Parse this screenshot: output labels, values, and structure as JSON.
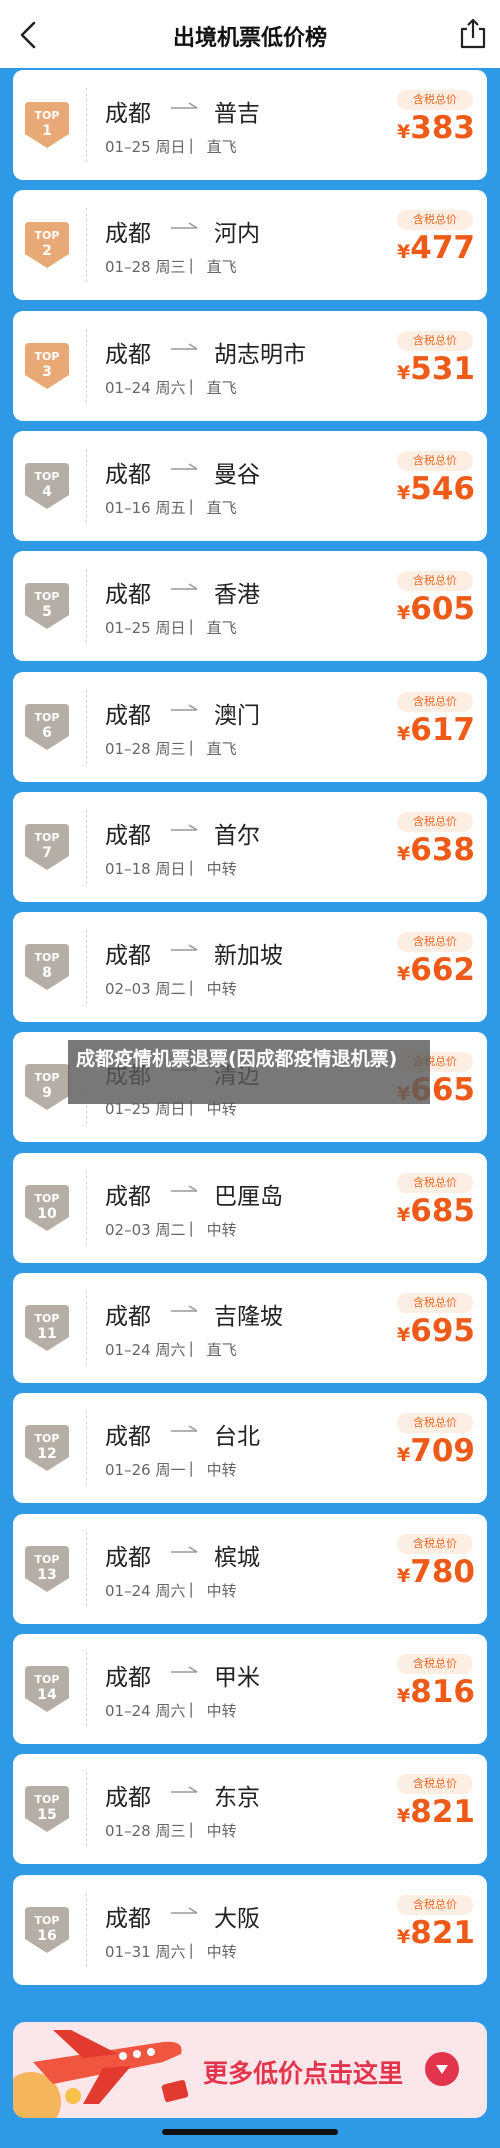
{
  "header": {
    "title": "出境机票低价榜"
  },
  "colors": {
    "accent": "#2e9ae6",
    "price": "#ee5a17",
    "badge_gold": "#e9a977",
    "badge_gray": "#b5aea6",
    "banner": "#e3344d"
  },
  "routes": [
    {
      "rank": "1",
      "from": "成都",
      "to": "普吉",
      "date": "01–25 周日",
      "type": "直飞",
      "tag": "含税总价",
      "currency": "¥",
      "price": "383",
      "tier": "gold"
    },
    {
      "rank": "2",
      "from": "成都",
      "to": "河内",
      "date": "01–28 周三",
      "type": "直飞",
      "tag": "含税总价",
      "currency": "¥",
      "price": "477",
      "tier": "gold"
    },
    {
      "rank": "3",
      "from": "成都",
      "to": "胡志明市",
      "date": "01–24 周六",
      "type": "直飞",
      "tag": "含税总价",
      "currency": "¥",
      "price": "531",
      "tier": "gold"
    },
    {
      "rank": "4",
      "from": "成都",
      "to": "曼谷",
      "date": "01–16 周五",
      "type": "直飞",
      "tag": "含税总价",
      "currency": "¥",
      "price": "546",
      "tier": "gray"
    },
    {
      "rank": "5",
      "from": "成都",
      "to": "香港",
      "date": "01–25 周日",
      "type": "直飞",
      "tag": "含税总价",
      "currency": "¥",
      "price": "605",
      "tier": "gray"
    },
    {
      "rank": "6",
      "from": "成都",
      "to": "澳门",
      "date": "01–28 周三",
      "type": "直飞",
      "tag": "含税总价",
      "currency": "¥",
      "price": "617",
      "tier": "gray"
    },
    {
      "rank": "7",
      "from": "成都",
      "to": "首尔",
      "date": "01–18 周日",
      "type": "中转",
      "tag": "含税总价",
      "currency": "¥",
      "price": "638",
      "tier": "gray"
    },
    {
      "rank": "8",
      "from": "成都",
      "to": "新加坡",
      "date": "02–03 周二",
      "type": "中转",
      "tag": "含税总价",
      "currency": "¥",
      "price": "662",
      "tier": "gray"
    },
    {
      "rank": "9",
      "from": "成都",
      "to": "清迈",
      "date": "01–25 周日",
      "type": "中转",
      "tag": "含税总价",
      "currency": "¥",
      "price": "665",
      "tier": "gray"
    },
    {
      "rank": "10",
      "from": "成都",
      "to": "巴厘岛",
      "date": "02–03 周二",
      "type": "中转",
      "tag": "含税总价",
      "currency": "¥",
      "price": "685",
      "tier": "gray"
    },
    {
      "rank": "11",
      "from": "成都",
      "to": "吉隆坡",
      "date": "01–24 周六",
      "type": "直飞",
      "tag": "含税总价",
      "currency": "¥",
      "price": "695",
      "tier": "gray"
    },
    {
      "rank": "12",
      "from": "成都",
      "to": "台北",
      "date": "01–26 周一",
      "type": "中转",
      "tag": "含税总价",
      "currency": "¥",
      "price": "709",
      "tier": "gray"
    },
    {
      "rank": "13",
      "from": "成都",
      "to": "槟城",
      "date": "01–24 周六",
      "type": "中转",
      "tag": "含税总价",
      "currency": "¥",
      "price": "780",
      "tier": "gray"
    },
    {
      "rank": "14",
      "from": "成都",
      "to": "甲米",
      "date": "01–24 周六",
      "type": "中转",
      "tag": "含税总价",
      "currency": "¥",
      "price": "816",
      "tier": "gray"
    },
    {
      "rank": "15",
      "from": "成都",
      "to": "东京",
      "date": "01–28 周三",
      "type": "中转",
      "tag": "含税总价",
      "currency": "¥",
      "price": "821",
      "tier": "gray"
    },
    {
      "rank": "16",
      "from": "成都",
      "to": "大阪",
      "date": "01–31 周六",
      "type": "中转",
      "tag": "含税总价",
      "currency": "¥",
      "price": "821",
      "tier": "gray"
    }
  ],
  "badge_label": "TOP",
  "separator": "|",
  "overlay": {
    "text": "成都疫情机票退票(因成都疫情退机票)"
  },
  "banner": {
    "text": "更多低价点击这里",
    "icon": "chevron-down-icon"
  }
}
